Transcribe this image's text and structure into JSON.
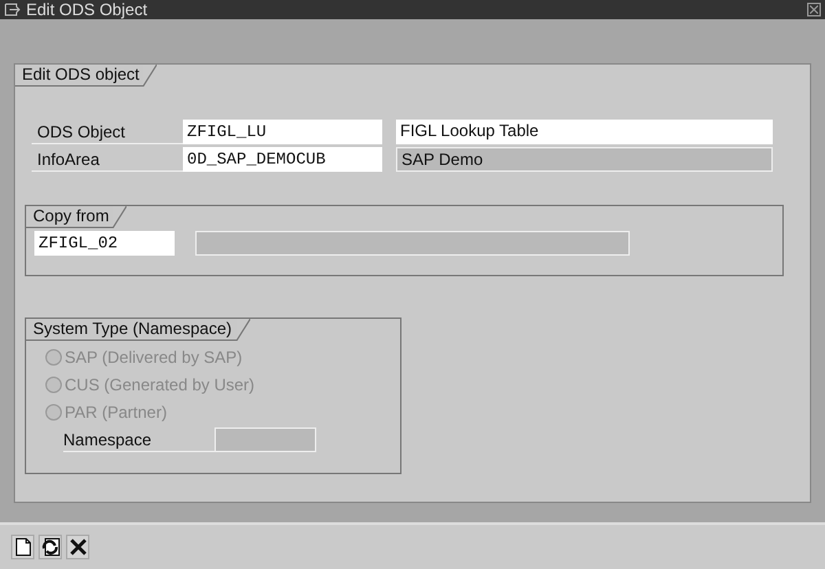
{
  "window": {
    "title": "Edit ODS Object"
  },
  "edit_group": {
    "title": "Edit ODS object",
    "rows": [
      {
        "label": "ODS Object",
        "value": "ZFIGL_LU",
        "description": "FIGL Lookup Table",
        "description_editable": true
      },
      {
        "label": "InfoArea",
        "value": "0D_SAP_DEMOCUB",
        "description": "SAP Demo",
        "description_editable": false
      }
    ]
  },
  "copy_from": {
    "title": "Copy from",
    "value": "ZFIGL_02"
  },
  "system_type": {
    "title": "System Type (Namespace)",
    "options": [
      {
        "label": "SAP (Delivered by SAP)",
        "selected": false,
        "disabled": true
      },
      {
        "label": "CUS (Generated by User)",
        "selected": false,
        "disabled": true
      },
      {
        "label": "PAR (Partner)",
        "selected": false,
        "disabled": true
      }
    ],
    "namespace_label": "Namespace"
  },
  "toolbar": [
    {
      "kind": "new"
    },
    {
      "kind": "refresh"
    },
    {
      "kind": "cancel"
    }
  ]
}
